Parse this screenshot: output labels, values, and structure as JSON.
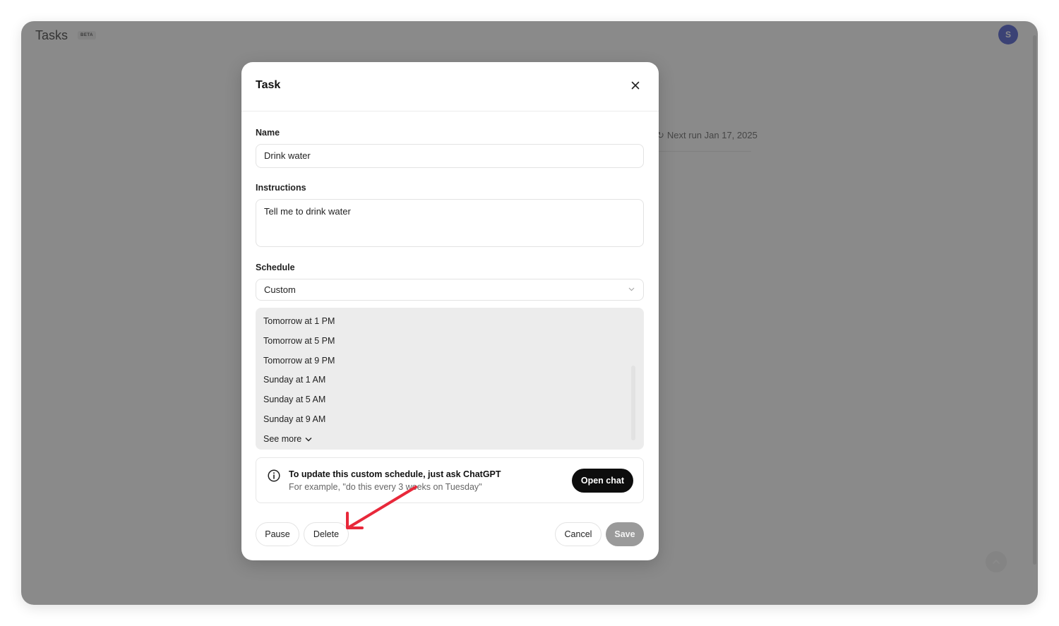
{
  "app": {
    "title": "Tasks",
    "badge": "BETA",
    "avatar_initial": "S",
    "avatar_color": "#3b4cca"
  },
  "background_task": {
    "next_run": "Next run Jan 17, 2025"
  },
  "modal": {
    "title": "Task",
    "close_icon": "close-icon",
    "name_label": "Name",
    "name_value": "Drink water",
    "instructions_label": "Instructions",
    "instructions_value": "Tell me to drink water",
    "schedule_label": "Schedule",
    "schedule_value": "Custom",
    "schedule_options": [
      "Tomorrow at 1 PM",
      "Tomorrow at 5 PM",
      "Tomorrow at 9 PM",
      "Sunday at 1 AM",
      "Sunday at 5 AM",
      "Sunday at 9 AM"
    ],
    "see_more_label": "See more",
    "info": {
      "title": "To update this custom schedule, just ask ChatGPT",
      "subtitle": "For example, \"do this every 3 weeks on Tuesday\"",
      "open_chat_label": "Open chat"
    },
    "footer": {
      "pause_label": "Pause",
      "delete_label": "Delete",
      "cancel_label": "Cancel",
      "save_label": "Save"
    }
  },
  "annotation": {
    "arrow_color": "#e8283a",
    "points_to": "delete-button"
  }
}
